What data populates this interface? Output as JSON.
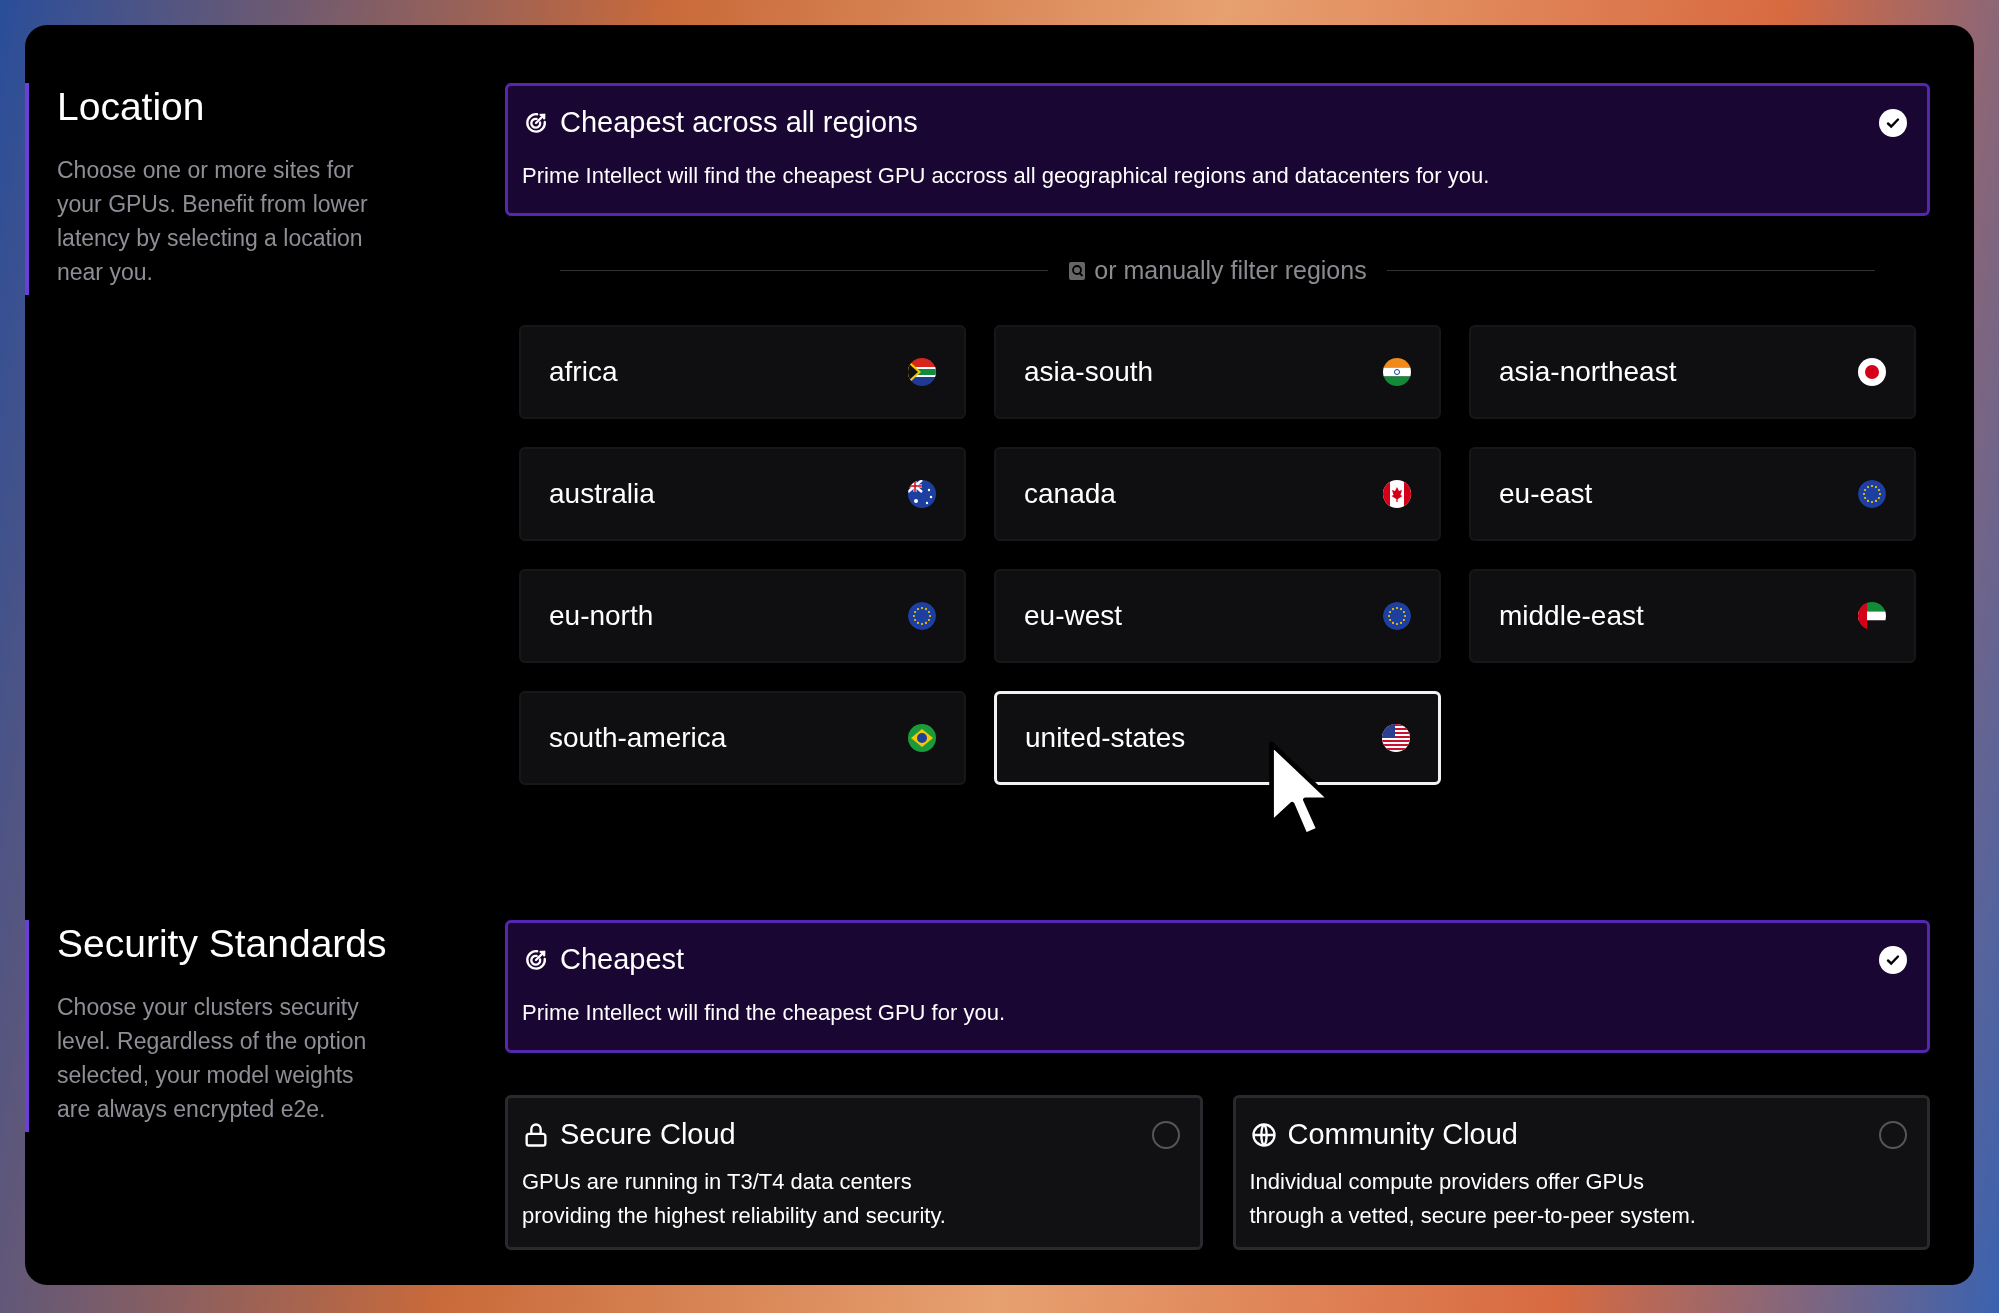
{
  "sections": [
    {
      "title": "Location",
      "description": "Choose one or more sites for your GPUs. Benefit from lower latency by selecting a location near you.",
      "featured": {
        "title": "Cheapest across all regions",
        "description": "Prime Intellect will find the cheapest GPU accross all geographical regions and datacenters for you.",
        "selected": true
      },
      "divider": "or manually filter regions",
      "regions": [
        {
          "label": "africa",
          "kind": "za",
          "selected": false
        },
        {
          "label": "asia-south",
          "kind": "in",
          "selected": false
        },
        {
          "label": "asia-northeast",
          "kind": "jp",
          "selected": false
        },
        {
          "label": "australia",
          "kind": "au",
          "selected": false
        },
        {
          "label": "canada",
          "kind": "ca",
          "selected": false
        },
        {
          "label": "eu-east",
          "kind": "eu",
          "selected": false
        },
        {
          "label": "eu-north",
          "kind": "eu",
          "selected": false
        },
        {
          "label": "eu-west",
          "kind": "eu",
          "selected": false
        },
        {
          "label": "middle-east",
          "kind": "ae",
          "selected": false
        },
        {
          "label": "south-america",
          "kind": "br",
          "selected": false
        },
        {
          "label": "united-states",
          "kind": "us",
          "selected": true
        }
      ]
    },
    {
      "title": "Security Standards",
      "description": "Choose your clusters security level. Regardless of the option selected, your model weights are always encrypted e2e.",
      "featured": {
        "title": "Cheapest",
        "description": "Prime Intellect will find the cheapest GPU for you.",
        "selected": true
      },
      "options": [
        {
          "title": "Secure Cloud",
          "kind": "lock",
          "lines": [
            "GPUs are running in T3/T4 data centers",
            "providing the highest reliability and security."
          ],
          "selected": false
        },
        {
          "title": "Community Cloud",
          "kind": "globe",
          "lines": [
            "Individual compute providers offer GPUs",
            "through a vetted, secure peer-to-peer system."
          ],
          "selected": false
        }
      ]
    }
  ]
}
